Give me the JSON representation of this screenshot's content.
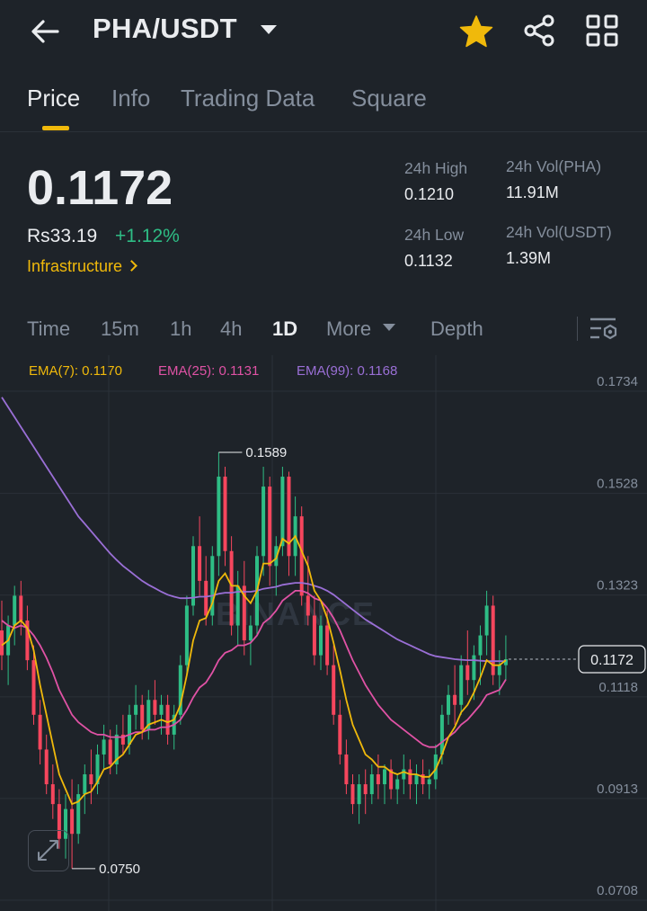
{
  "header": {
    "pair": "PHA/USDT",
    "icons": [
      "back-arrow-icon",
      "caret-down-icon",
      "favorite-star-icon",
      "share-icon",
      "grid-menu-icon"
    ]
  },
  "tabs": [
    {
      "label": "Price",
      "active": true
    },
    {
      "label": "Info",
      "active": false
    },
    {
      "label": "Trading Data",
      "active": false
    },
    {
      "label": "Square",
      "active": false
    }
  ],
  "ticker": {
    "price": "0.1172",
    "fiat": "Rs33.19",
    "change": "+1.12%",
    "sector": "Infrastructure"
  },
  "stats": {
    "high_label": "24h High",
    "high_value": "0.1210",
    "low_label": "24h Low",
    "low_value": "0.1132",
    "vol_base_label": "24h Vol(PHA)",
    "vol_base_value": "11.91M",
    "vol_quote_label": "24h Vol(USDT)",
    "vol_quote_value": "1.39M"
  },
  "intervals": [
    {
      "label": "Time",
      "active": false
    },
    {
      "label": "15m",
      "active": false
    },
    {
      "label": "1h",
      "active": false
    },
    {
      "label": "4h",
      "active": false
    },
    {
      "label": "1D",
      "active": true
    },
    {
      "label": "More",
      "active": false
    },
    {
      "label": "Depth",
      "active": false
    }
  ],
  "indicators": {
    "ema7": "EMA(7): 0.1170",
    "ema25": "EMA(25): 0.1131",
    "ema99": "EMA(99): 0.1168"
  },
  "colors": {
    "accent": "#f0b90b",
    "up": "#2ebd85",
    "down": "#f6465d",
    "ema7": "#f0b90b",
    "ema25": "#e052a5",
    "ema99": "#9a6fd6"
  },
  "chart_data": {
    "type": "candlestick",
    "y_ticks": [
      "0.1734",
      "0.1528",
      "0.1323",
      "0.1118",
      "0.0913",
      "0.0708"
    ],
    "ylim": [
      0.0708,
      0.1734
    ],
    "last_price_label": "0.1172",
    "max_label": "0.1589",
    "min_label": "0.0750",
    "watermark": "BINANCE",
    "candles": [
      [
        0.123,
        0.129,
        0.115,
        0.118
      ],
      [
        0.118,
        0.126,
        0.112,
        0.124
      ],
      [
        0.124,
        0.132,
        0.12,
        0.13
      ],
      [
        0.13,
        0.133,
        0.122,
        0.125
      ],
      [
        0.125,
        0.128,
        0.115,
        0.117
      ],
      [
        0.117,
        0.12,
        0.104,
        0.106
      ],
      [
        0.106,
        0.109,
        0.096,
        0.099
      ],
      [
        0.099,
        0.102,
        0.09,
        0.092
      ],
      [
        0.092,
        0.096,
        0.085,
        0.088
      ],
      [
        0.088,
        0.091,
        0.079,
        0.081
      ],
      [
        0.081,
        0.09,
        0.077,
        0.087
      ],
      [
        0.087,
        0.093,
        0.075,
        0.082
      ],
      [
        0.082,
        0.092,
        0.08,
        0.09
      ],
      [
        0.09,
        0.096,
        0.086,
        0.094
      ],
      [
        0.094,
        0.099,
        0.088,
        0.092
      ],
      [
        0.092,
        0.1,
        0.09,
        0.098
      ],
      [
        0.098,
        0.104,
        0.095,
        0.101
      ],
      [
        0.101,
        0.103,
        0.094,
        0.096
      ],
      [
        0.096,
        0.104,
        0.094,
        0.102
      ],
      [
        0.102,
        0.106,
        0.098,
        0.1
      ],
      [
        0.1,
        0.108,
        0.098,
        0.106
      ],
      [
        0.106,
        0.112,
        0.103,
        0.108
      ],
      [
        0.108,
        0.11,
        0.101,
        0.103
      ],
      [
        0.103,
        0.111,
        0.101,
        0.109
      ],
      [
        0.109,
        0.113,
        0.104,
        0.106
      ],
      [
        0.106,
        0.11,
        0.102,
        0.108
      ],
      [
        0.108,
        0.11,
        0.1,
        0.102
      ],
      [
        0.102,
        0.108,
        0.099,
        0.106
      ],
      [
        0.106,
        0.118,
        0.104,
        0.116
      ],
      [
        0.116,
        0.13,
        0.114,
        0.128
      ],
      [
        0.128,
        0.142,
        0.126,
        0.14
      ],
      [
        0.14,
        0.146,
        0.13,
        0.133
      ],
      [
        0.133,
        0.138,
        0.124,
        0.126
      ],
      [
        0.126,
        0.14,
        0.124,
        0.138
      ],
      [
        0.138,
        0.1589,
        0.134,
        0.154
      ],
      [
        0.154,
        0.156,
        0.136,
        0.139
      ],
      [
        0.139,
        0.142,
        0.122,
        0.124
      ],
      [
        0.124,
        0.135,
        0.12,
        0.132
      ],
      [
        0.132,
        0.137,
        0.118,
        0.121
      ],
      [
        0.121,
        0.126,
        0.116,
        0.124
      ],
      [
        0.124,
        0.14,
        0.122,
        0.138
      ],
      [
        0.138,
        0.156,
        0.134,
        0.152
      ],
      [
        0.152,
        0.154,
        0.132,
        0.136
      ],
      [
        0.136,
        0.142,
        0.13,
        0.14
      ],
      [
        0.14,
        0.156,
        0.138,
        0.154
      ],
      [
        0.154,
        0.155,
        0.134,
        0.138
      ],
      [
        0.138,
        0.15,
        0.134,
        0.146
      ],
      [
        0.146,
        0.148,
        0.128,
        0.13
      ],
      [
        0.13,
        0.138,
        0.124,
        0.126
      ],
      [
        0.126,
        0.13,
        0.116,
        0.118
      ],
      [
        0.118,
        0.126,
        0.115,
        0.124
      ],
      [
        0.124,
        0.127,
        0.114,
        0.116
      ],
      [
        0.116,
        0.12,
        0.104,
        0.106
      ],
      [
        0.106,
        0.109,
        0.096,
        0.098
      ],
      [
        0.098,
        0.101,
        0.09,
        0.092
      ],
      [
        0.092,
        0.094,
        0.086,
        0.088
      ],
      [
        0.088,
        0.094,
        0.084,
        0.092
      ],
      [
        0.092,
        0.095,
        0.086,
        0.09
      ],
      [
        0.09,
        0.096,
        0.088,
        0.094
      ],
      [
        0.094,
        0.098,
        0.089,
        0.092
      ],
      [
        0.092,
        0.096,
        0.088,
        0.095
      ],
      [
        0.095,
        0.097,
        0.089,
        0.091
      ],
      [
        0.091,
        0.094,
        0.088,
        0.093
      ],
      [
        0.093,
        0.098,
        0.09,
        0.095
      ],
      [
        0.095,
        0.097,
        0.089,
        0.092
      ],
      [
        0.092,
        0.096,
        0.088,
        0.094
      ],
      [
        0.094,
        0.097,
        0.09,
        0.092
      ],
      [
        0.092,
        0.095,
        0.089,
        0.093
      ],
      [
        0.093,
        0.1,
        0.091,
        0.098
      ],
      [
        0.098,
        0.108,
        0.096,
        0.106
      ],
      [
        0.106,
        0.112,
        0.104,
        0.11
      ],
      [
        0.11,
        0.116,
        0.104,
        0.108
      ],
      [
        0.108,
        0.118,
        0.106,
        0.116
      ],
      [
        0.116,
        0.123,
        0.11,
        0.113
      ],
      [
        0.113,
        0.12,
        0.109,
        0.118
      ],
      [
        0.118,
        0.124,
        0.112,
        0.122
      ],
      [
        0.122,
        0.131,
        0.118,
        0.128
      ],
      [
        0.128,
        0.13,
        0.112,
        0.114
      ],
      [
        0.114,
        0.119,
        0.11,
        0.116
      ],
      [
        0.116,
        0.122,
        0.113,
        0.1172
      ]
    ],
    "ema7": [
      0.12,
      0.121,
      0.124,
      0.125,
      0.1235,
      0.119,
      0.112,
      0.106,
      0.1,
      0.094,
      0.091,
      0.088,
      0.0885,
      0.09,
      0.0905,
      0.0925,
      0.095,
      0.0955,
      0.097,
      0.098,
      0.1,
      0.102,
      0.1025,
      0.104,
      0.1045,
      0.105,
      0.1045,
      0.105,
      0.108,
      0.114,
      0.121,
      0.125,
      0.1255,
      0.1285,
      0.133,
      0.1345,
      0.132,
      0.132,
      0.13,
      0.1285,
      0.131,
      0.1365,
      0.1365,
      0.1375,
      0.1415,
      0.1405,
      0.142,
      0.139,
      0.136,
      0.131,
      0.129,
      0.1255,
      0.1205,
      0.115,
      0.109,
      0.104,
      0.101,
      0.098,
      0.097,
      0.0955,
      0.0955,
      0.0945,
      0.094,
      0.0945,
      0.094,
      0.094,
      0.0935,
      0.0935,
      0.095,
      0.098,
      0.1015,
      0.1035,
      0.1065,
      0.108,
      0.1105,
      0.1135,
      0.117,
      0.116,
      0.116,
      0.117
    ],
    "ema25": [
      0.125,
      0.124,
      0.1235,
      0.124,
      0.1235,
      0.122,
      0.12,
      0.1175,
      0.1145,
      0.111,
      0.1085,
      0.106,
      0.1045,
      0.1035,
      0.1025,
      0.102,
      0.102,
      0.1015,
      0.1015,
      0.1015,
      0.102,
      0.1025,
      0.1025,
      0.103,
      0.103,
      0.1035,
      0.1035,
      0.104,
      0.105,
      0.107,
      0.1095,
      0.1115,
      0.1125,
      0.1145,
      0.117,
      0.1185,
      0.119,
      0.12,
      0.12,
      0.1205,
      0.122,
      0.1245,
      0.1255,
      0.127,
      0.129,
      0.13,
      0.131,
      0.131,
      0.1305,
      0.1295,
      0.129,
      0.1275,
      0.1255,
      0.123,
      0.12,
      0.117,
      0.1145,
      0.112,
      0.11,
      0.108,
      0.1065,
      0.105,
      0.104,
      0.103,
      0.102,
      0.101,
      0.1,
      0.0995,
      0.0995,
      0.1005,
      0.1015,
      0.1025,
      0.104,
      0.105,
      0.1065,
      0.108,
      0.11,
      0.1105,
      0.111,
      0.1131
    ],
    "ema99": [
      0.17,
      0.168,
      0.166,
      0.164,
      0.162,
      0.16,
      0.158,
      0.156,
      0.154,
      0.152,
      0.15,
      0.148,
      0.146,
      0.1445,
      0.143,
      0.1415,
      0.14,
      0.1385,
      0.1372,
      0.136,
      0.135,
      0.134,
      0.133,
      0.1322,
      0.1315,
      0.1308,
      0.1302,
      0.1298,
      0.1295,
      0.1295,
      0.1296,
      0.1298,
      0.1298,
      0.13,
      0.1304,
      0.1306,
      0.1306,
      0.1308,
      0.1308,
      0.1308,
      0.131,
      0.1314,
      0.1316,
      0.1318,
      0.1322,
      0.1324,
      0.1326,
      0.1326,
      0.1324,
      0.132,
      0.1316,
      0.131,
      0.1302,
      0.1292,
      0.1282,
      0.1272,
      0.1262,
      0.1252,
      0.1244,
      0.1236,
      0.1228,
      0.122,
      0.1212,
      0.1206,
      0.12,
      0.1194,
      0.1188,
      0.1182,
      0.1178,
      0.1176,
      0.1174,
      0.1172,
      0.1171,
      0.117,
      0.117,
      0.1169,
      0.1168,
      0.1168,
      0.1168,
      0.1168
    ]
  }
}
